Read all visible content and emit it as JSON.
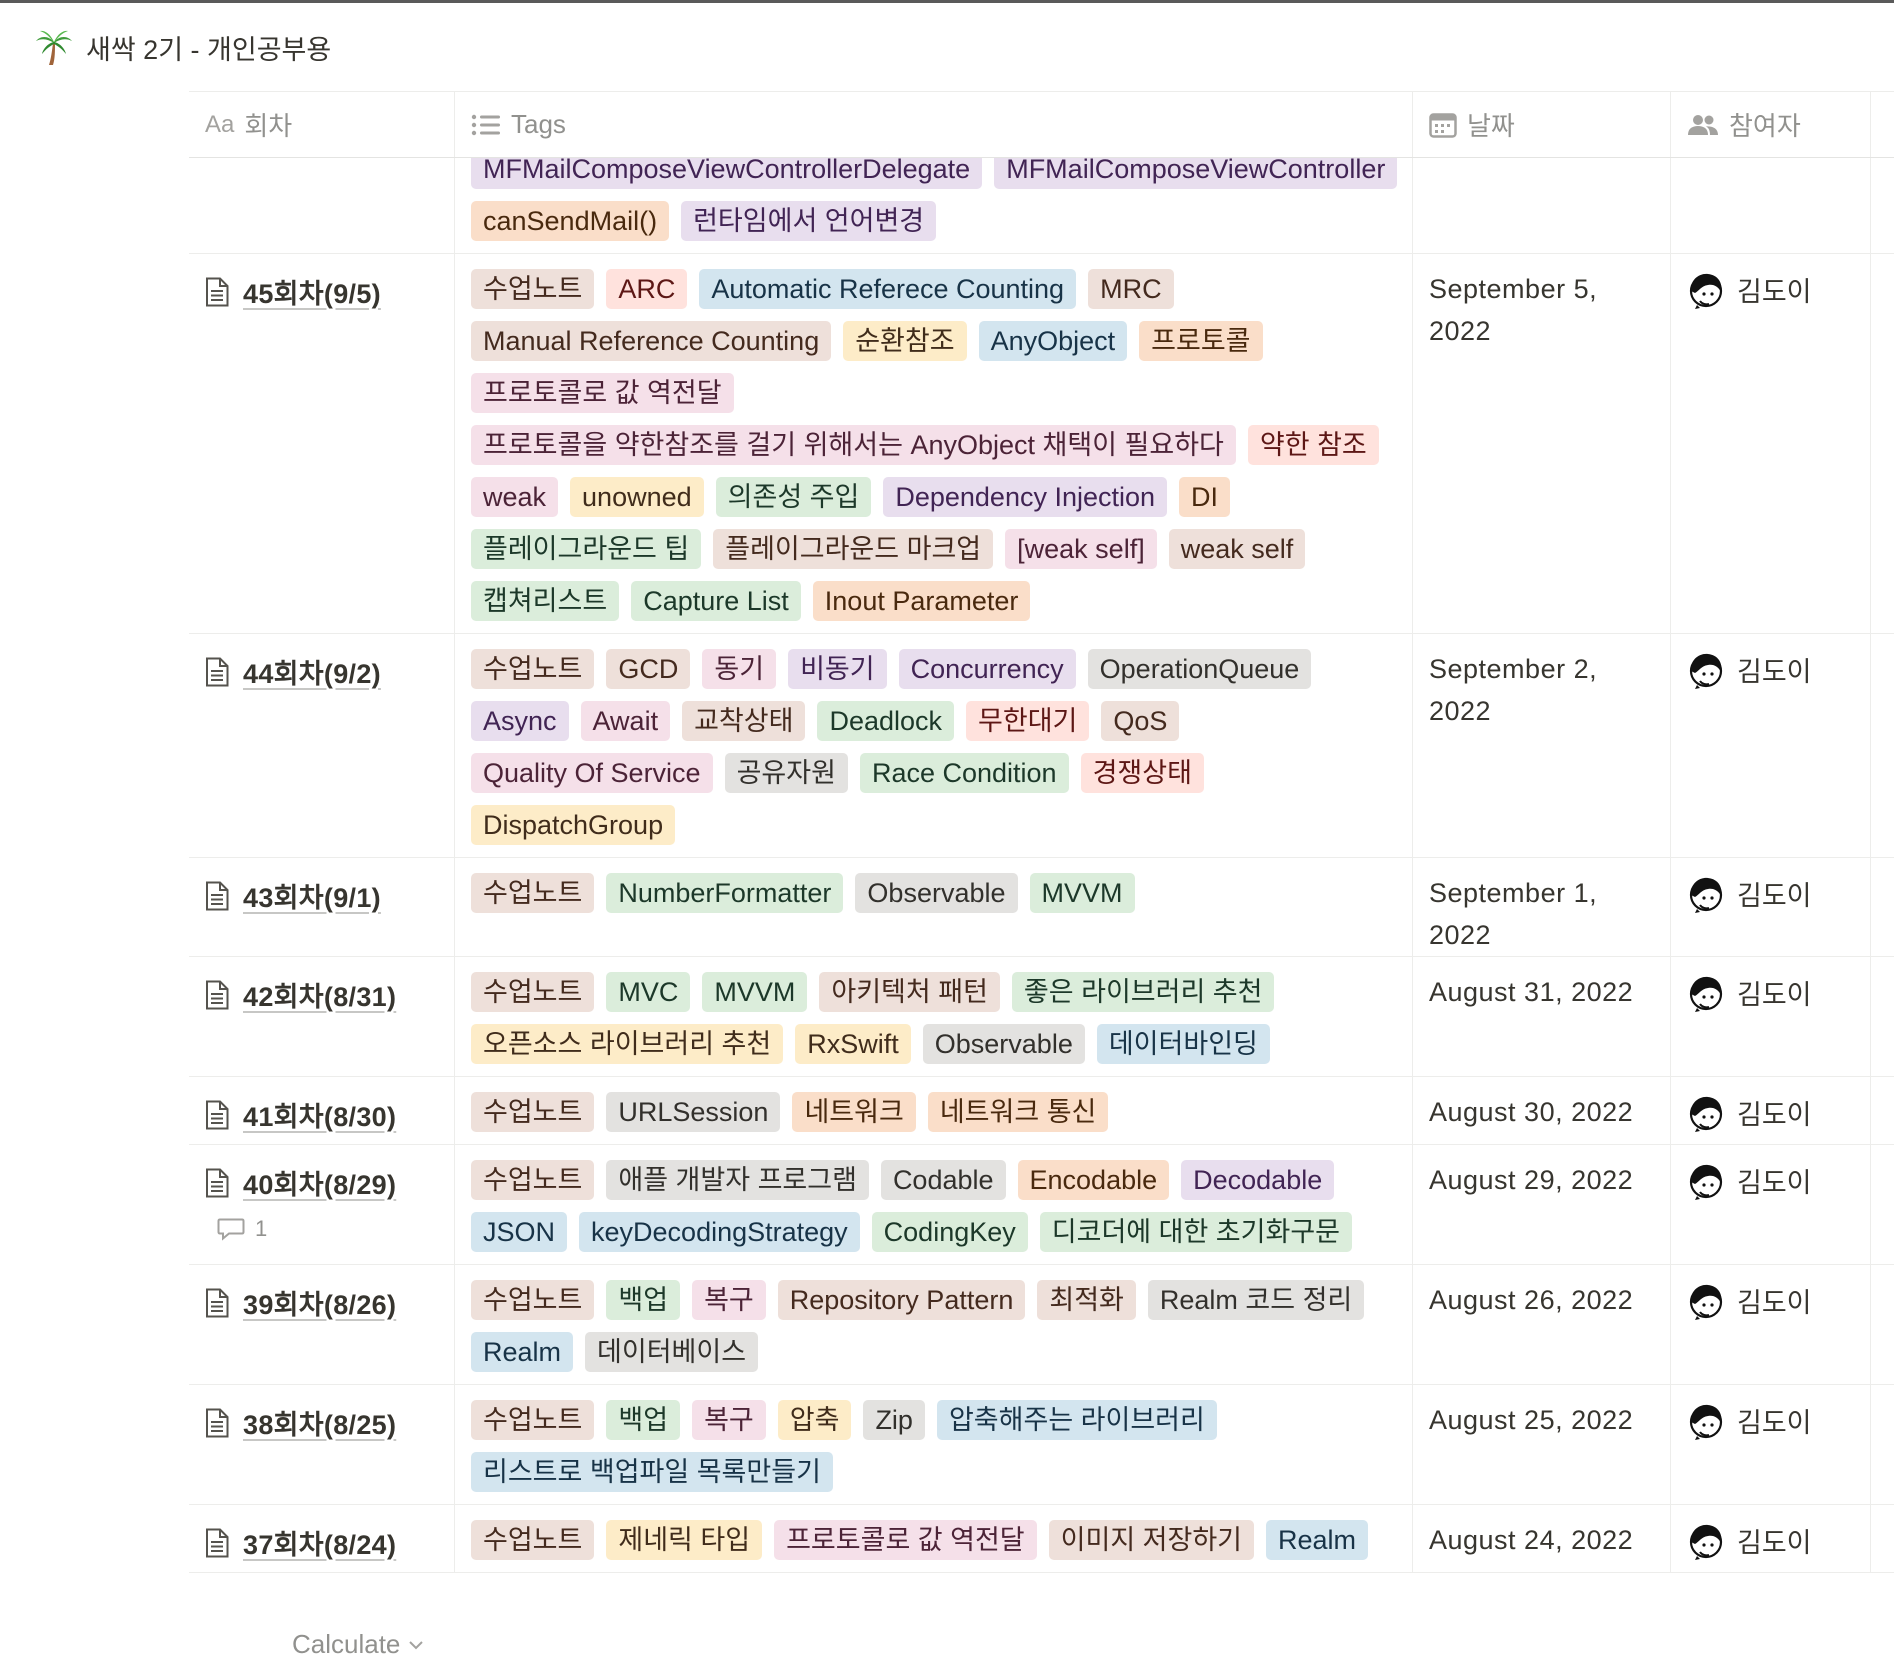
{
  "page": {
    "title": "새싹 2기 - 개인공부용",
    "icon": "palm-tree-icon"
  },
  "columns": {
    "name": "회차",
    "tags": "Tags",
    "date": "날짜",
    "people": "참여자"
  },
  "tag_colors": {
    "default": "#e3e2e0",
    "brown": "#eee0da",
    "orange": "#fadec9",
    "yellow": "#fdecc8",
    "green": "#dbeddb",
    "blue": "#d3e5ef",
    "purple": "#e8deee",
    "pink": "#f5e0e9",
    "red": "#ffe2dd"
  },
  "rows": [
    {
      "name": "",
      "date": "",
      "person": "",
      "tags": [
        {
          "text": "MFMailComposeViewControllerDelegate",
          "color": "purple"
        },
        {
          "text": "MFMailComposeViewController",
          "color": "purple"
        },
        {
          "text": "canSendMail()",
          "color": "orange"
        },
        {
          "text": "런타임에서 언어변경",
          "color": "purple"
        }
      ]
    },
    {
      "name": "45회차(9/5)",
      "date": "September 5, 2022",
      "person": "김도이",
      "tags": [
        {
          "text": "수업노트",
          "color": "brown"
        },
        {
          "text": "ARC",
          "color": "red"
        },
        {
          "text": "Automatic Referece Counting",
          "color": "blue"
        },
        {
          "text": "MRC",
          "color": "brown"
        },
        {
          "text": "Manual Reference Counting",
          "color": "brown"
        },
        {
          "text": "순환참조",
          "color": "yellow"
        },
        {
          "text": "AnyObject",
          "color": "blue"
        },
        {
          "text": "프로토콜",
          "color": "orange"
        },
        {
          "text": "프로토콜로 값 역전달",
          "color": "pink"
        },
        {
          "text": "프로토콜을 약한참조를 걸기 위해서는 AnyObject 채택이 필요하다",
          "color": "pink"
        },
        {
          "text": "약한 참조",
          "color": "red"
        },
        {
          "text": "weak",
          "color": "pink"
        },
        {
          "text": "unowned",
          "color": "yellow"
        },
        {
          "text": "의존성 주입",
          "color": "green"
        },
        {
          "text": "Dependency Injection",
          "color": "purple"
        },
        {
          "text": "DI",
          "color": "orange"
        },
        {
          "text": "플레이그라운드 팁",
          "color": "green"
        },
        {
          "text": "플레이그라운드 마크업",
          "color": "brown"
        },
        {
          "text": "[weak self]",
          "color": "pink"
        },
        {
          "text": "weak self",
          "color": "brown"
        },
        {
          "text": "캡쳐리스트",
          "color": "green"
        },
        {
          "text": "Capture List",
          "color": "green"
        },
        {
          "text": "Inout Parameter",
          "color": "orange"
        }
      ]
    },
    {
      "name": "44회차(9/2)",
      "date": "September 2, 2022",
      "person": "김도이",
      "tags": [
        {
          "text": "수업노트",
          "color": "brown"
        },
        {
          "text": "GCD",
          "color": "brown"
        },
        {
          "text": "동기",
          "color": "pink"
        },
        {
          "text": "비동기",
          "color": "purple"
        },
        {
          "text": "Concurrency",
          "color": "purple"
        },
        {
          "text": "OperationQueue",
          "color": "default"
        },
        {
          "text": "Async",
          "color": "purple"
        },
        {
          "text": "Await",
          "color": "pink"
        },
        {
          "text": "교착상태",
          "color": "brown"
        },
        {
          "text": "Deadlock",
          "color": "green"
        },
        {
          "text": "무한대기",
          "color": "red"
        },
        {
          "text": "QoS",
          "color": "brown"
        },
        {
          "text": "Quality Of Service",
          "color": "pink"
        },
        {
          "text": "공유자원",
          "color": "default"
        },
        {
          "text": "Race Condition",
          "color": "green"
        },
        {
          "text": "경쟁상태",
          "color": "red"
        },
        {
          "text": "DispatchGroup",
          "color": "yellow"
        }
      ]
    },
    {
      "name": "43회차(9/1)",
      "date": "September 1, 2022",
      "person": "김도이",
      "tags": [
        {
          "text": "수업노트",
          "color": "brown"
        },
        {
          "text": "NumberFormatter",
          "color": "green"
        },
        {
          "text": "Observable",
          "color": "default"
        },
        {
          "text": "MVVM",
          "color": "green"
        }
      ]
    },
    {
      "name": "42회차(8/31)",
      "date": "August 31, 2022",
      "person": "김도이",
      "tags": [
        {
          "text": "수업노트",
          "color": "brown"
        },
        {
          "text": "MVC",
          "color": "green"
        },
        {
          "text": "MVVM",
          "color": "green"
        },
        {
          "text": "아키텍처 패턴",
          "color": "brown"
        },
        {
          "text": "좋은 라이브러리 추천",
          "color": "green"
        },
        {
          "text": "오픈소스 라이브러리 추천",
          "color": "yellow"
        },
        {
          "text": "RxSwift",
          "color": "yellow"
        },
        {
          "text": "Observable",
          "color": "default"
        },
        {
          "text": "데이터바인딩",
          "color": "blue"
        }
      ]
    },
    {
      "name": "41회차(8/30)",
      "date": "August 30, 2022",
      "person": "김도이",
      "tags": [
        {
          "text": "수업노트",
          "color": "brown"
        },
        {
          "text": "URLSession",
          "color": "default"
        },
        {
          "text": "네트워크",
          "color": "orange"
        },
        {
          "text": "네트워크 통신",
          "color": "orange"
        }
      ]
    },
    {
      "name": "40회차(8/29)",
      "date": "August 29, 2022",
      "person": "김도이",
      "comments": "1",
      "tags": [
        {
          "text": "수업노트",
          "color": "brown"
        },
        {
          "text": "애플 개발자 프로그램",
          "color": "default"
        },
        {
          "text": "Codable",
          "color": "default"
        },
        {
          "text": "Encodable",
          "color": "orange"
        },
        {
          "text": "Decodable",
          "color": "purple"
        },
        {
          "text": "JSON",
          "color": "blue"
        },
        {
          "text": "keyDecodingStrategy",
          "color": "blue"
        },
        {
          "text": "CodingKey",
          "color": "green"
        },
        {
          "text": "디코더에 대한 초기화구문",
          "color": "green"
        }
      ]
    },
    {
      "name": "39회차(8/26)",
      "date": "August 26, 2022",
      "person": "김도이",
      "tags": [
        {
          "text": "수업노트",
          "color": "brown"
        },
        {
          "text": "백업",
          "color": "green"
        },
        {
          "text": "복구",
          "color": "pink"
        },
        {
          "text": "Repository Pattern",
          "color": "brown"
        },
        {
          "text": "최적화",
          "color": "brown"
        },
        {
          "text": "Realm 코드 정리",
          "color": "default"
        },
        {
          "text": "Realm",
          "color": "blue"
        },
        {
          "text": "데이터베이스",
          "color": "default"
        }
      ]
    },
    {
      "name": "38회차(8/25)",
      "date": "August 25, 2022",
      "person": "김도이",
      "tags": [
        {
          "text": "수업노트",
          "color": "brown"
        },
        {
          "text": "백업",
          "color": "green"
        },
        {
          "text": "복구",
          "color": "pink"
        },
        {
          "text": "압축",
          "color": "yellow"
        },
        {
          "text": "Zip",
          "color": "default"
        },
        {
          "text": "압축해주는 라이브러리",
          "color": "blue"
        },
        {
          "text": "리스트로 백업파일 목록만들기",
          "color": "blue"
        }
      ]
    },
    {
      "name": "37회차(8/24)",
      "date": "August 24, 2022",
      "person": "김도이",
      "tags": [
        {
          "text": "수업노트",
          "color": "brown"
        },
        {
          "text": "제네릭 타입",
          "color": "yellow"
        },
        {
          "text": "프로토콜로 값 역전달",
          "color": "pink"
        },
        {
          "text": "이미지 저장하기",
          "color": "brown"
        },
        {
          "text": "Realm",
          "color": "blue"
        }
      ]
    }
  ],
  "footer": {
    "calculate_label": "Calculate"
  }
}
